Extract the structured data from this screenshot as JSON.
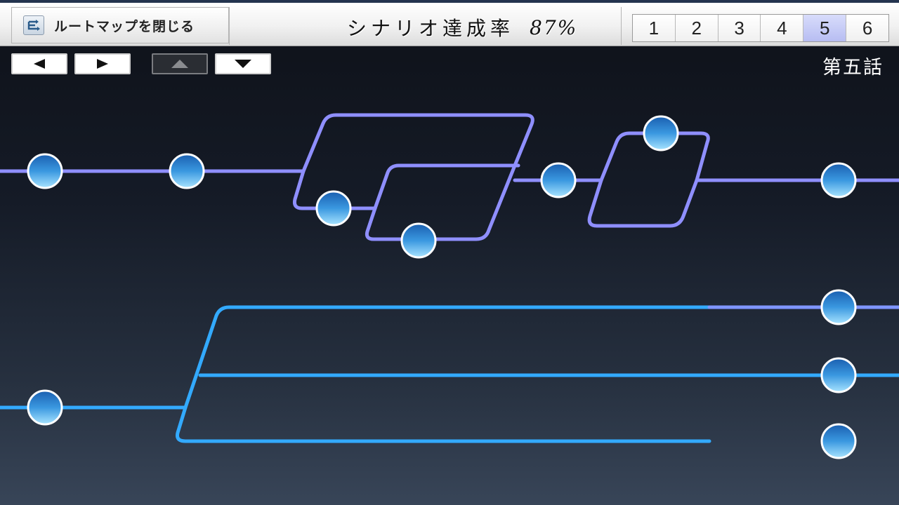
{
  "header": {
    "close_label": "ルートマップを閉じる",
    "completion_label": "シナリオ達成率",
    "completion_value": "87%",
    "pages": [
      "1",
      "2",
      "3",
      "4",
      "5",
      "6"
    ],
    "active_page": "5"
  },
  "nav": {
    "left": "left-arrow-icon",
    "right": "right-arrow-icon",
    "up": "up-arrow-icon",
    "down": "down-arrow-icon"
  },
  "episode_title": "第五話",
  "colors": {
    "route_purple": "#8f8fff",
    "route_blue": "#33aaff",
    "node_fill": "#5fb6ef",
    "active_page": "#b7bdf2"
  }
}
